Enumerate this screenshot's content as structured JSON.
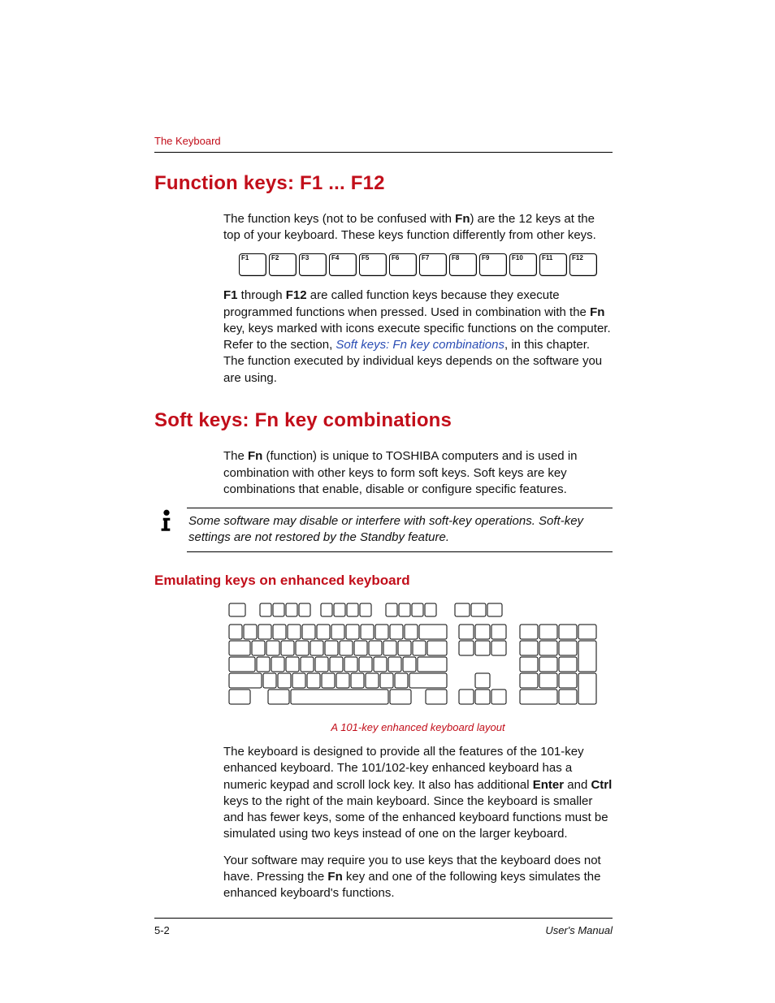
{
  "header": {
    "running": "The Keyboard"
  },
  "sections": {
    "funcKeys": {
      "title": "Function keys: F1 ... F12",
      "p1a": "The function keys (not to be confused with ",
      "p1b_bold": "Fn",
      "p1c": ") are the 12 keys at the top of your keyboard. These keys function differently from other keys.",
      "fkeys": [
        "F1",
        "F2",
        "F3",
        "F4",
        "F5",
        "F6",
        "F7",
        "F8",
        "F9",
        "F10",
        "F11",
        "F12"
      ],
      "p2a_bold": "F1",
      "p2b": " through ",
      "p2c_bold": "F12",
      "p2d": " are called function keys because they execute programmed functions when pressed. Used in combination with the ",
      "p2e_bold": "Fn",
      "p2f": " key, keys marked with icons execute specific functions on the computer. Refer to the section, ",
      "p2g_link": "Soft keys: Fn key combinations",
      "p2h": ", in this chapter. The function executed by individual keys depends on the software you are using."
    },
    "softKeys": {
      "title": "Soft keys: Fn key combinations",
      "p1a": "The ",
      "p1b_bold": "Fn",
      "p1c": " (function) is unique to TOSHIBA computers and is used in combination with other keys to form soft keys. Soft keys are key combinations that enable, disable or configure specific features.",
      "note": "Some software may disable or interfere with soft-key operations. Soft-key settings are not restored by the Standby feature.",
      "sub": "Emulating keys on enhanced keyboard",
      "caption": "A 101-key enhanced keyboard layout",
      "p2a": "The keyboard is designed to provide all the features of the 101-key enhanced keyboard. The 101/102-key enhanced keyboard has a numeric keypad and scroll lock key. It also has additional ",
      "p2b_bold": "Enter",
      "p2c": " and ",
      "p2d_bold": "Ctrl",
      "p2e": " keys to the right of the main keyboard. Since the keyboard is smaller and has fewer keys, some of the enhanced keyboard functions must be simulated using two keys instead of one on the larger keyboard.",
      "p3a": "Your software may require you to use keys that the keyboard does not have. Pressing the ",
      "p3b_bold": "Fn",
      "p3c": " key and one of the following keys simulates the enhanced keyboard's functions."
    }
  },
  "footer": {
    "page": "5-2",
    "doc": "User's Manual"
  }
}
